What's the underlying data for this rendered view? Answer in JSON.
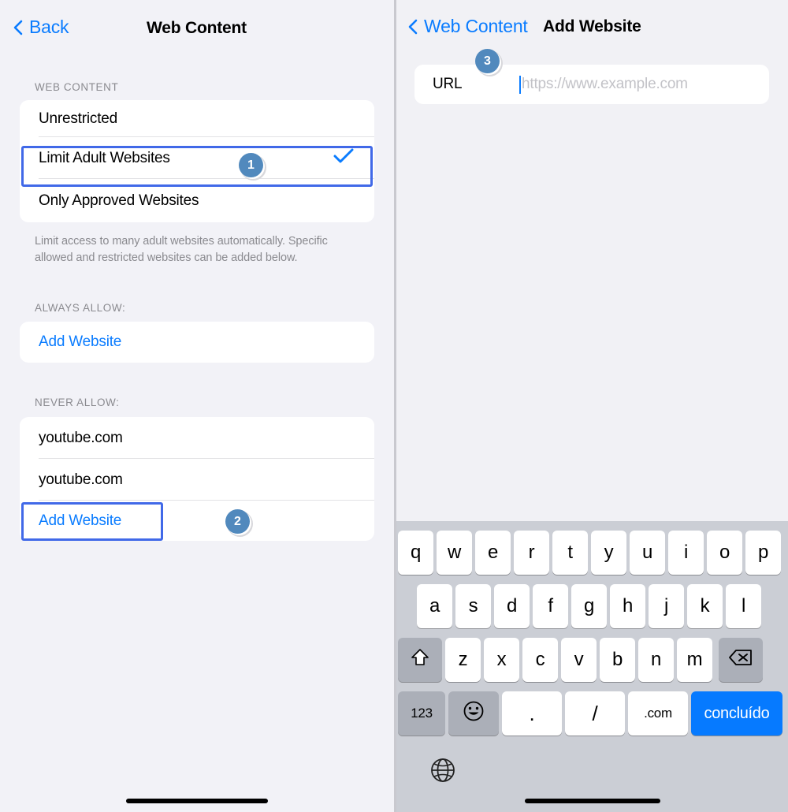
{
  "left": {
    "nav": {
      "back_label": "Back",
      "back_icon": "chevron-left-icon",
      "title": "Web Content"
    },
    "sections": [
      {
        "header": "WEB CONTENT",
        "rows": [
          {
            "label": "Unrestricted",
            "checked": false
          },
          {
            "label": "Limit Adult Websites",
            "checked": true
          },
          {
            "label": "Only Approved Websites",
            "checked": false
          }
        ],
        "footnote": "Limit access to many adult websites automatically. Specific allowed and restricted websites can be added below."
      },
      {
        "header": "ALWAYS ALLOW:",
        "rows": [
          {
            "label": "Add Website",
            "link": true
          }
        ]
      },
      {
        "header": "NEVER ALLOW:",
        "rows": [
          {
            "label": "youtube.com"
          },
          {
            "label": "youtube.com"
          },
          {
            "label": "Add Website",
            "link": true
          }
        ]
      }
    ]
  },
  "right": {
    "nav": {
      "back_label": "Web Content",
      "back_icon": "chevron-left-icon",
      "title": "Add Website"
    },
    "url_field": {
      "label": "URL",
      "value": "",
      "placeholder": "https://www.example.com"
    },
    "keyboard": {
      "row1": [
        "q",
        "w",
        "e",
        "r",
        "t",
        "y",
        "u",
        "i",
        "o",
        "p"
      ],
      "row2": [
        "a",
        "s",
        "d",
        "f",
        "g",
        "h",
        "j",
        "k",
        "l"
      ],
      "row3": [
        "z",
        "x",
        "c",
        "v",
        "b",
        "n",
        "m"
      ],
      "shift_icon": "shift-arrow-icon",
      "backspace_icon": "backspace-icon",
      "numbers_label": "123",
      "emoji_icon": "emoji-smiley-icon",
      "period_label": ".",
      "slash_label": "/",
      "dotcom_label": ".com",
      "done_label": "concluído",
      "globe_icon": "globe-icon"
    }
  },
  "badges": [
    {
      "number": "1"
    },
    {
      "number": "2"
    },
    {
      "number": "3"
    }
  ],
  "colors": {
    "accent_blue": "#0a7cff",
    "highlight_blue": "#4169e8",
    "badge_blue": "#5189bd",
    "key_blue": "#067aff",
    "background": "#f2f2f7"
  }
}
